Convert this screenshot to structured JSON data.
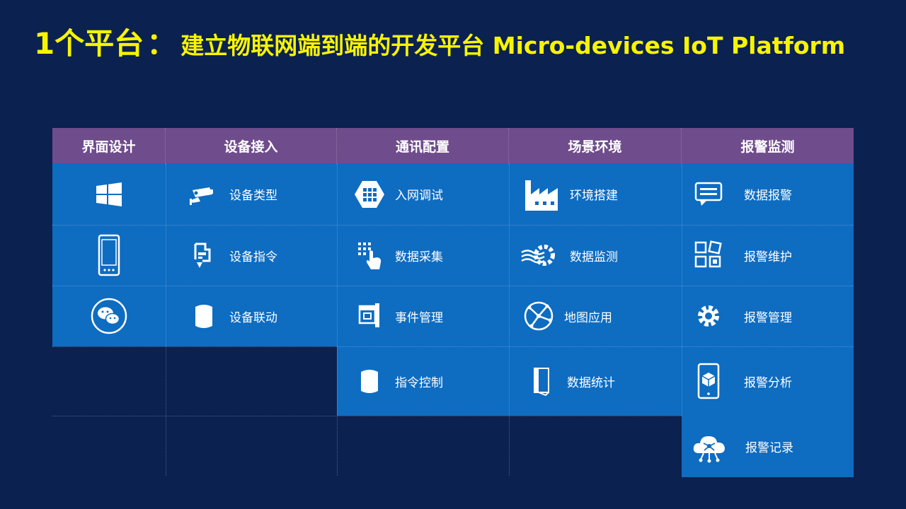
{
  "title": {
    "prefix": "1个平台",
    "separator": "：",
    "main": "建立物联网端到端的开发平台 Micro-devices IoT Platform"
  },
  "columns": [
    {
      "label": "界面设计"
    },
    {
      "label": "设备接入"
    },
    {
      "label": "通讯配置"
    },
    {
      "label": "场景环境"
    },
    {
      "label": "报警监测"
    }
  ],
  "ui_design": {
    "icons": [
      "windows-icon",
      "mobile-phone-icon",
      "wechat-icon"
    ]
  },
  "device_access": {
    "items": [
      {
        "label": "设备类型",
        "icon": "camera-icon"
      },
      {
        "label": "设备指令",
        "icon": "device-command-icon"
      },
      {
        "label": "设备联动",
        "icon": "cylinder-icon"
      }
    ]
  },
  "comm_config": {
    "items": [
      {
        "label": "入网调试",
        "icon": "grid-hexagon-icon"
      },
      {
        "label": "数据采集",
        "icon": "touch-grid-icon"
      },
      {
        "label": "事件管理",
        "icon": "window-panel-icon"
      },
      {
        "label": "指令控制",
        "icon": "cylinder-icon"
      }
    ]
  },
  "scene": {
    "items": [
      {
        "label": "环境搭建",
        "icon": "factory-icon"
      },
      {
        "label": "数据监测",
        "icon": "gear-waves-icon"
      },
      {
        "label": "地图应用",
        "icon": "globe-network-icon"
      },
      {
        "label": "数据统计",
        "icon": "book-icon"
      }
    ]
  },
  "alarm": {
    "items": [
      {
        "label": "数据报警",
        "icon": "message-alert-icon"
      },
      {
        "label": "报警维护",
        "icon": "maintenance-grid-icon"
      },
      {
        "label": "报警管理",
        "icon": "gear-icon"
      },
      {
        "label": "报警分析",
        "icon": "phone-cube-icon"
      },
      {
        "label": "报警记录",
        "icon": "cloud-network-icon"
      }
    ]
  },
  "colors": {
    "background": "#0b2150",
    "header": "#6f4c8c",
    "tile": "#0e6cc1",
    "title": "#f8f400"
  }
}
